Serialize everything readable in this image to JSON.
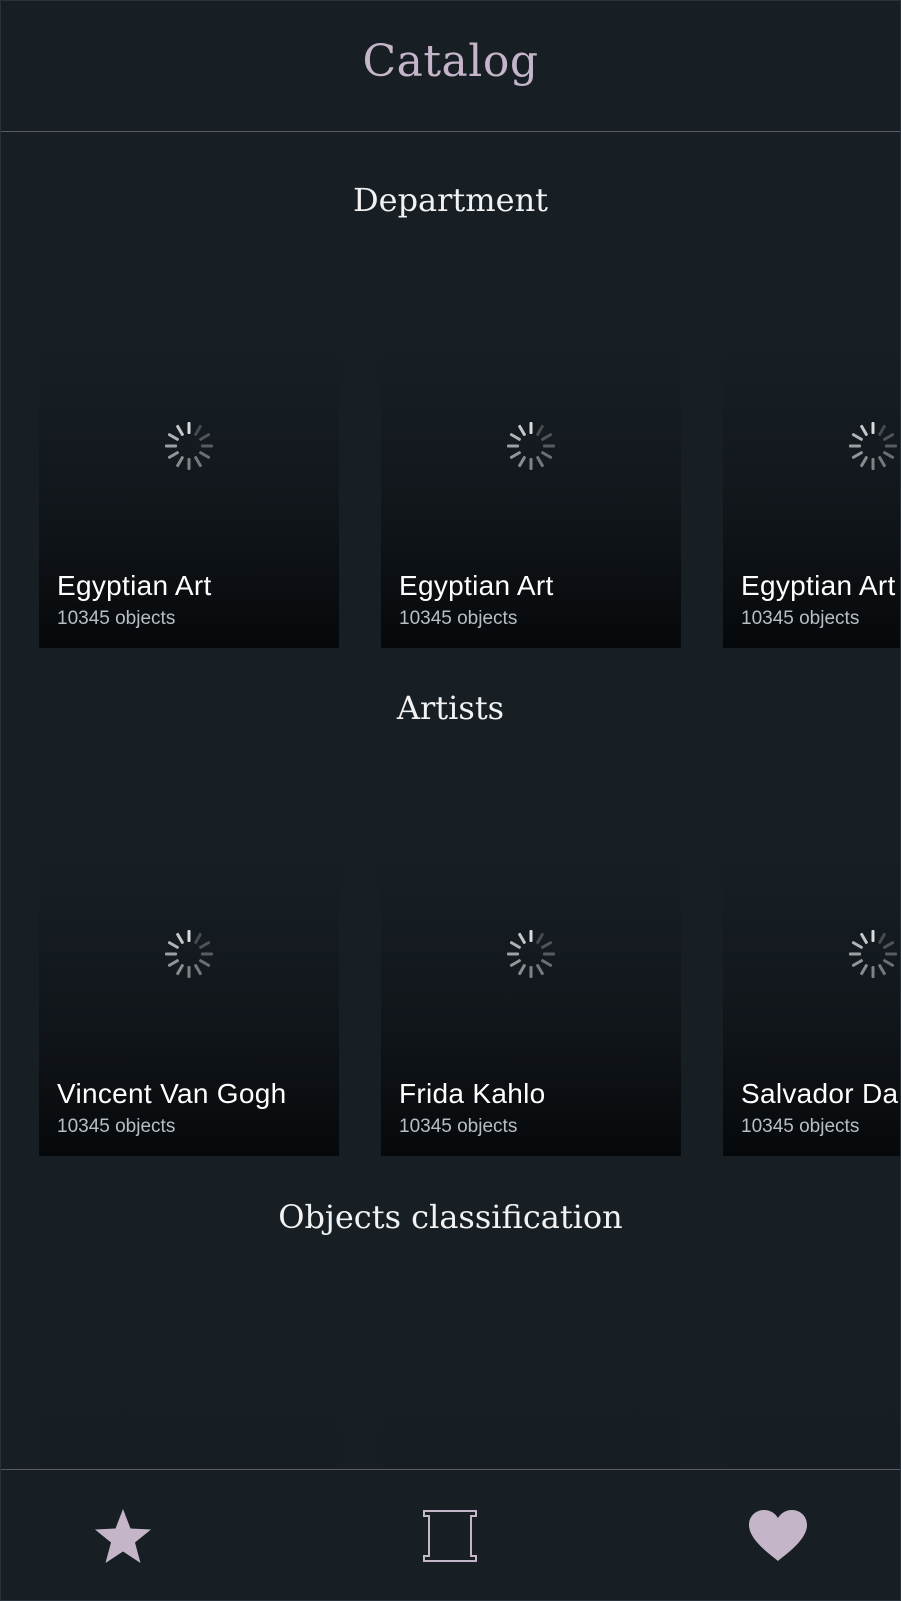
{
  "header": {
    "title": "Catalog"
  },
  "sections": [
    {
      "title": "Department",
      "cards": [
        {
          "title": "Egyptian Art",
          "count": "10345 objects"
        },
        {
          "title": "Egyptian Art",
          "count": "10345 objects"
        },
        {
          "title": "Egyptian Art",
          "count": "10345 objects"
        }
      ]
    },
    {
      "title": "Artists",
      "cards": [
        {
          "title": "Vincent Van Gogh",
          "count": "10345 objects"
        },
        {
          "title": "Frida Kahlo",
          "count": "10345 objects"
        },
        {
          "title": "Salvador Dali",
          "count": "10345 objects"
        }
      ]
    },
    {
      "title": "Objects classification",
      "cards": [
        {},
        {},
        {}
      ]
    }
  ],
  "tabbar": {
    "tabs": [
      {
        "icon": "star-icon"
      },
      {
        "icon": "frame-icon"
      },
      {
        "icon": "heart-icon"
      }
    ]
  },
  "colors": {
    "background": "#171f25",
    "accent": "#c4b5c8",
    "divider": "#5c5866"
  }
}
